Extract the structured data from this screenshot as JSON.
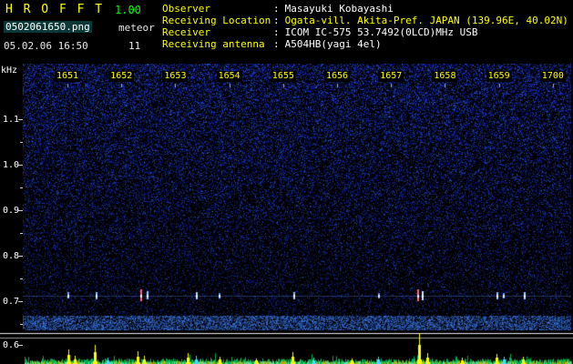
{
  "header": {
    "app_title": "H R O F F T",
    "version": "1.00",
    "filename": "0502061650.png",
    "mode": "meteor",
    "datetime": "05.02.06 16:50",
    "count": "11",
    "separator": ":",
    "info": [
      {
        "label": "Observer",
        "value": "Masayuki Kobayashi"
      },
      {
        "label": "Receiving Location",
        "value": "Ogata-vill. Akita-Pref. JAPAN (139.96E, 40.02N)"
      },
      {
        "label": "Receiver",
        "value": "ICOM IC-575 53.7492(0LCD)MHz USB"
      },
      {
        "label": "Receiving antenna",
        "value": "A504HB(yagi 4el)"
      }
    ]
  },
  "spectrogram": {
    "freq_unit": "kHz",
    "freq_ticks": [
      "1.1",
      "1.0",
      "0.9",
      "0.8",
      "0.7",
      "0.6"
    ],
    "time_ticks": [
      "1651",
      "1652",
      "1653",
      "1654",
      "1655",
      "1656",
      "1657",
      "1658",
      "1659",
      "1700"
    ],
    "echo_line_khz": "0.7",
    "echoes": [
      {
        "x": 0.081,
        "h": 7,
        "color": "#77aaff"
      },
      {
        "x": 0.133,
        "h": 8,
        "color": "#88ccff"
      },
      {
        "x": 0.214,
        "h": 13,
        "color": "#ff6688"
      },
      {
        "x": 0.226,
        "h": 9,
        "color": "#88ccff"
      },
      {
        "x": 0.316,
        "h": 8,
        "color": "#99ddff"
      },
      {
        "x": 0.357,
        "h": 6,
        "color": "#6699ff"
      },
      {
        "x": 0.493,
        "h": 8,
        "color": "#88ccff"
      },
      {
        "x": 0.648,
        "h": 6,
        "color": "#5588dd"
      },
      {
        "x": 0.719,
        "h": 13,
        "color": "#ff6688"
      },
      {
        "x": 0.728,
        "h": 10,
        "color": "#bbeeff"
      },
      {
        "x": 0.864,
        "h": 8,
        "color": "#88ccff"
      },
      {
        "x": 0.876,
        "h": 6,
        "color": "#6699ff"
      },
      {
        "x": 0.913,
        "h": 8,
        "color": "#99ddff"
      }
    ]
  },
  "level_plot": {
    "peaks": [
      {
        "x": 0.083,
        "h": 16,
        "color": "#ffff00"
      },
      {
        "x": 0.094,
        "h": 9,
        "color": "#ffff00"
      },
      {
        "x": 0.132,
        "h": 21,
        "color": "#ffff00"
      },
      {
        "x": 0.155,
        "h": 7,
        "color": "#44ddff"
      },
      {
        "x": 0.209,
        "h": 14,
        "color": "#ffff00"
      },
      {
        "x": 0.221,
        "h": 9,
        "color": "#ffff00"
      },
      {
        "x": 0.3,
        "h": 12,
        "color": "#ffff00"
      },
      {
        "x": 0.316,
        "h": 9,
        "color": "#44ddff"
      },
      {
        "x": 0.358,
        "h": 8,
        "color": "#ffff00"
      },
      {
        "x": 0.425,
        "h": 6,
        "color": "#ffff00"
      },
      {
        "x": 0.492,
        "h": 13,
        "color": "#ffff00"
      },
      {
        "x": 0.53,
        "h": 7,
        "color": "#44ddff"
      },
      {
        "x": 0.6,
        "h": 6,
        "color": "#ffff00"
      },
      {
        "x": 0.648,
        "h": 8,
        "color": "#44ddff"
      },
      {
        "x": 0.722,
        "h": 34,
        "color": "#ffff00"
      },
      {
        "x": 0.737,
        "h": 12,
        "color": "#ffff00"
      },
      {
        "x": 0.8,
        "h": 7,
        "color": "#ffff00"
      },
      {
        "x": 0.864,
        "h": 11,
        "color": "#ffff00"
      },
      {
        "x": 0.877,
        "h": 8,
        "color": "#44ddff"
      },
      {
        "x": 0.912,
        "h": 8,
        "color": "#ffff00"
      }
    ]
  },
  "colors": {
    "title": "#ffff00",
    "version": "#00ff00",
    "info_label": "#ffff00",
    "info_value": "#ffffff",
    "time_label": "#ffff00",
    "freq_label": "#ffffff",
    "noise_blue": "#2244aa",
    "level_green": "#00b050",
    "level_yellow": "#ffff00"
  }
}
